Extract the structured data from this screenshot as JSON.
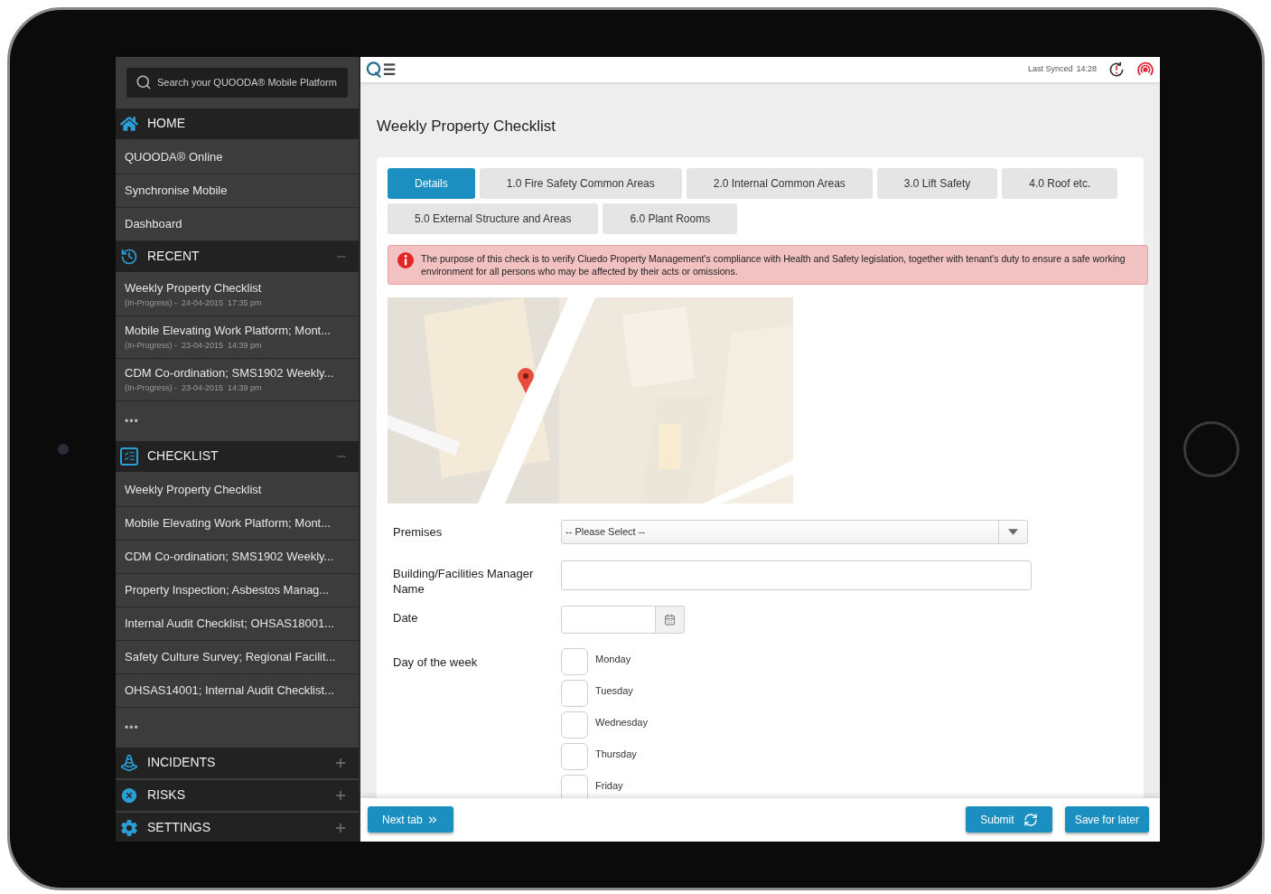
{
  "sidebar": {
    "search": {
      "placeholder": "Search your QUOODA® Mobile Platform"
    },
    "sections": [
      {
        "kind": "plain",
        "title": "HOME",
        "items": [
          {
            "label": "QUOODA® Online"
          },
          {
            "label": "Synchronise Mobile"
          },
          {
            "label": "Dashboard"
          }
        ]
      },
      {
        "kind": "group",
        "title": "RECENT",
        "expanded": true,
        "items": [
          {
            "label": "Weekly Property Checklist",
            "status": "(In-Progress) -  24-04-2015  17:35 pm"
          },
          {
            "label": "Mobile Elevating Work Platform; Mont...",
            "status": "(In-Progress) -  23-04-2015  14:39 pm"
          },
          {
            "label": "CDM Co-ordination; SMS1902 Weekly...",
            "status": "(In-Progress) -  23-04-2015  14:39 pm"
          }
        ],
        "more": "•••"
      },
      {
        "kind": "group",
        "title": "CHECKLIST",
        "expanded": true,
        "items": [
          {
            "label": "Weekly Property Checklist"
          },
          {
            "label": "Mobile Elevating Work Platform; Mont..."
          },
          {
            "label": "CDM Co-ordination; SMS1902 Weekly..."
          },
          {
            "label": "Property Inspection; Asbestos Manag..."
          },
          {
            "label": "Internal Audit Checklist; OHSAS18001..."
          },
          {
            "label": "Safety Culture Survey; Regional Facilit..."
          },
          {
            "label": "OHSAS14001; Internal Audit Checklist..."
          }
        ],
        "more": "•••"
      },
      {
        "kind": "group",
        "title": "INCIDENTS",
        "expanded": false
      },
      {
        "kind": "group",
        "title": "RISKS",
        "expanded": false
      },
      {
        "kind": "group",
        "title": "SETTINGS",
        "expanded": false
      }
    ]
  },
  "topbar": {
    "sync_label": "Last Synced",
    "sync_time": "14:28"
  },
  "page": {
    "title": "Weekly Property Checklist"
  },
  "tabs": [
    {
      "label": "Details",
      "selected": true
    },
    {
      "label": "1.0 Fire Safety Common Areas",
      "selected": false
    },
    {
      "label": "2.0 Internal Common Areas",
      "selected": false
    },
    {
      "label": "3.0 Lift Safety",
      "selected": false
    },
    {
      "label": "4.0 Roof etc.",
      "selected": false
    },
    {
      "label": "5.0 External Structure and Areas",
      "selected": false
    },
    {
      "label": "6.0 Plant Rooms",
      "selected": false
    }
  ],
  "alert": {
    "text": "The purpose of this check is to verify Cluedo Property Management's compliance with Health and Safety legislation, together with tenant's duty to ensure a safe working environment for all persons who may be affected by their acts or omissions."
  },
  "form": {
    "fields": [
      {
        "kind": "select",
        "label": "Premises",
        "placeholder": "-- Please Select --"
      },
      {
        "kind": "text",
        "label": "Building/Facilities Manager Name"
      },
      {
        "kind": "date",
        "label": "Date"
      },
      {
        "kind": "checkboxes",
        "label": "Day of the week",
        "options": [
          {
            "label": "Monday",
            "checked": false
          },
          {
            "label": "Tuesday",
            "checked": false
          },
          {
            "label": "Wednesday",
            "checked": false
          },
          {
            "label": "Thursday",
            "checked": false
          },
          {
            "label": "Friday",
            "checked": false
          }
        ]
      }
    ]
  },
  "footer": {
    "next": "Next tab",
    "submit": "Submit",
    "save": "Save for later"
  }
}
